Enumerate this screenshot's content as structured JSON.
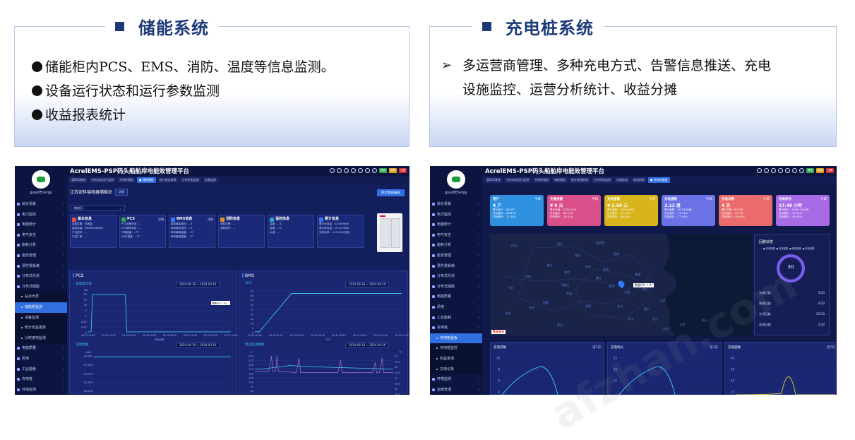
{
  "left_panel": {
    "title": "储能系统",
    "bullets": [
      "储能柜内PCS、EMS、消防、温度等信息监测。",
      "设备运行状态和运行参数监测",
      "收益报表统计"
    ]
  },
  "right_panel": {
    "title": "充电桩系统",
    "bullet_arrow": "➢",
    "bullet_lines": [
      "多运营商管理、多种充电方式、告警信息推送、充电",
      "设施监控、运营分析统计、收益分摊"
    ]
  },
  "app": {
    "title": "AcrelEMS-PSP码头船舶岸电能效管理平台",
    "brand": "guestEnergy",
    "top_tags": [
      {
        "label": "微信",
        "color": "#2fa84f"
      },
      {
        "label": "帮助",
        "color": "#e0a020"
      },
      {
        "label": "注销",
        "color": "#d03030"
      }
    ]
  },
  "shot1": {
    "tabs": [
      "管理驾驶舱",
      "光伏电站运行监测",
      "充电桩看板",
      "● 储能看板",
      "统计收益报表",
      "分时用电监测",
      "设备监测"
    ],
    "menu": [
      {
        "label": "综合看板",
        "type": "main"
      },
      {
        "label": "电力监控",
        "type": "main"
      },
      {
        "label": "电能统计",
        "type": "main"
      },
      {
        "label": "电气安全",
        "type": "main"
      },
      {
        "label": "能耗分析",
        "type": "main"
      },
      {
        "label": "能态管理",
        "type": "main"
      },
      {
        "label": "预付费系统",
        "type": "main"
      },
      {
        "label": "分布式光伏",
        "type": "main"
      },
      {
        "label": "分布式储能",
        "type": "main"
      },
      {
        "label": "站点大屏",
        "type": "sub"
      },
      {
        "label": "储能柜监测",
        "type": "sub-active"
      },
      {
        "label": "设备监测",
        "type": "sub"
      },
      {
        "label": "统计收益报表",
        "type": "sub"
      },
      {
        "label": "分时用电监测",
        "type": "sub"
      },
      {
        "label": "电能质量",
        "type": "main"
      },
      {
        "label": "风电",
        "type": "main"
      },
      {
        "label": "工业能耗",
        "type": "main"
      },
      {
        "label": "充电桩",
        "type": "main"
      },
      {
        "label": "环境监测",
        "type": "main"
      }
    ],
    "station": "江苏安科瑞电器储能站",
    "switch_label": "切换",
    "report_btn": "统计收益报表",
    "select_label": "储能柜1",
    "cards": [
      {
        "title": "基本信息",
        "color": "#e05050",
        "detail": "",
        "lines": [
          "站机位置：东面端",
          "装机容量：50kW/100kWh",
          "产品型号：--",
          "产品厂家：--"
        ]
      },
      {
        "title": "PCS",
        "color": "#2fa84f",
        "detail": "详情",
        "lines": [
          "PCS告警状态：--",
          "PCS故障状态：--",
          "环境温度：--℃",
          "IGBT温度：--℃"
        ]
      },
      {
        "title": "BMS信息",
        "color": "#3578ff",
        "detail": "详情",
        "lines": [
          "单体最高电压：--V",
          "单体最低电压：--V",
          "单体最高温度：--℃",
          "单体最低温度：--℃"
        ]
      },
      {
        "title": "消防信息",
        "color": "#e09020",
        "detail": "",
        "lines": [
          "消防告警：--",
          "消防动作：--"
        ]
      },
      {
        "title": "温控信息",
        "color": "#30a0d0",
        "detail": "",
        "lines": [
          "温度：--℃",
          "湿度：--%",
          "水浸：--"
        ]
      },
      {
        "title": "累计信息",
        "color": "#3578ff",
        "detail": "",
        "lines": [
          "累计充电量：31.08 MWh",
          "累计放电量：15.12 MWh",
          "当前功率：1.03 kW (充电)"
        ]
      }
    ],
    "pcs_section": "PCS",
    "bms_section": "BMS",
    "date_from": "2024-09-19",
    "date_to": "2024-09-19",
    "date_sep": "→",
    "charts": {
      "power": {
        "title": "充放电功率",
        "unit": "kW",
        "y_ticks": [
          "20",
          "15",
          "10",
          "5",
          "1",
          "0.67",
          "0.47",
          "0"
        ],
        "x_ticks": [
          "09 19 00:00",
          "09 19 02:50",
          "09 19 04:40",
          "09 19 06:30",
          "09 19 08:20",
          "09 19 11:10",
          "09 19 13:00",
          "09 19 14:15"
        ],
        "legend": "有功功率",
        "tooltip": "数据(kV + A)"
      },
      "soc": {
        "title": "SOC",
        "y_ticks": [
          "45",
          "40",
          "35",
          "30",
          "25",
          "20",
          "15",
          "10",
          "5",
          "0"
        ],
        "x_ticks": [
          "09 19 00:00",
          "09 19 02:10",
          "09 19 04:20",
          "09 19 06:30",
          "09 19 08:40",
          "09 19 10:50",
          "09 19 13:00",
          "09 19 14:15"
        ],
        "legend": "SOC"
      },
      "energy": {
        "title": "充放电量",
        "unit": "kWh",
        "y_ticks": [
          "30,000",
          "27,000",
          "24,000",
          "21,000",
          "18,000",
          "15,119.86"
        ],
        "x_ticks": [
          "09 19 00:00",
          "09 19 02:20",
          "09 19 04:40",
          "09 19 07:00",
          "09 19 09:20",
          "09 19 11:40",
          "09 19 14:00"
        ],
        "legend_a": "充电量",
        "legend_b": "放电量"
      },
      "cell_v": {
        "title": "电池监测曲线",
        "unit_left": "V",
        "unit_right": "℃",
        "y_ticks": [
          "250",
          "225",
          "200",
          "175",
          "150",
          "125",
          "100",
          "75",
          "50",
          "25",
          "0"
        ],
        "y_ticks_r": [
          "37",
          "35.5",
          "34",
          "32.5",
          "31",
          "29.5",
          "28",
          "26.5",
          "25"
        ],
        "x_ticks": [
          "09 19 00:00",
          "09 19 02:20",
          "09 19 04:40",
          "09 19 07:00",
          "09 19 09:20",
          "09 19 11:40",
          "09 19 14:00"
        ],
        "legend_a": "电压",
        "legend_b": "温度"
      }
    }
  },
  "shot2": {
    "tabs": [
      "管理驾驶舱",
      "光伏电站运行监测",
      "充电桩看板",
      "储能看板",
      "统计收益报表",
      "分时用电监测",
      "设备监测",
      "收益报表",
      "● 充电桩看板"
    ],
    "menu": [
      {
        "label": "综合看板",
        "type": "main"
      },
      {
        "label": "电力监控",
        "type": "main"
      },
      {
        "label": "电能统计",
        "type": "main"
      },
      {
        "label": "电气安全",
        "type": "main"
      },
      {
        "label": "能耗分析",
        "type": "main"
      },
      {
        "label": "能态管理",
        "type": "main"
      },
      {
        "label": "预付费系统",
        "type": "main"
      },
      {
        "label": "分布式光伏",
        "type": "main"
      },
      {
        "label": "分布式储能",
        "type": "main"
      },
      {
        "label": "电能质量",
        "type": "main"
      },
      {
        "label": "风电",
        "type": "main"
      },
      {
        "label": "工业能耗",
        "type": "main"
      },
      {
        "label": "充电桩",
        "type": "main"
      },
      {
        "label": "充电桩看板",
        "type": "sub-active"
      },
      {
        "label": "充电桩监控",
        "type": "sub"
      },
      {
        "label": "收益查询",
        "type": "sub"
      },
      {
        "label": "充电记录",
        "type": "sub"
      },
      {
        "label": "环境监测",
        "type": "main"
      },
      {
        "label": "运维管理",
        "type": "main"
      }
    ],
    "kpis": [
      {
        "title": "用户",
        "value": "4 户",
        "lines": [
          "累计用户：1621户",
          "环比增长：-56.67%",
          "同比增长：-21.58%"
        ],
        "color": "#2f90e0"
      },
      {
        "title": "充值金额",
        "value": "¥ 0 元",
        "lines": [
          "累计充值：1232.01元",
          "环比增长：-82.13%",
          "同比增长：-30.41%"
        ],
        "color": "#d94f8a"
      },
      {
        "title": "充电金额",
        "value": "¥ 2.50 元",
        "lines": [
          "累计金额：12844.06元",
          "环比增长：-72.87%",
          "同比增长：-66.63%"
        ],
        "color": "#d8b51d"
      },
      {
        "title": "充电度数",
        "value": "3.13 度",
        "lines": [
          "累计度数：25273.86度",
          "环比增长：-72.53%",
          "同比增长：-77.41%"
        ],
        "color": "#6a72e6"
      },
      {
        "title": "充电次数",
        "value": "4 次",
        "lines": [
          "累计次数：6145次",
          "环比增长：-47.1%",
          "同比增长：-46.41%"
        ],
        "color": "#ea6b6b"
      },
      {
        "title": "充电时长",
        "value": "17.48 小时",
        "lines": [
          "累计时长：17401.67小时",
          "环比增长：-42.74%",
          "同比增长：-45.91%"
        ],
        "color": "#a86be6"
      }
    ],
    "kpi_today": "今日",
    "map_labels": [
      "徐州",
      "宿迁",
      "连云港",
      "淮安",
      "盐城",
      "泰州",
      "南京",
      "扬州",
      "镇江",
      "常州",
      "无锡",
      "苏州",
      "上海",
      "嘉兴",
      "湖州",
      "杭州",
      "宣城",
      "芜湖",
      "马鞍山",
      "滁州",
      "合肥",
      "六安",
      "安庆",
      "铜陵",
      "池州",
      "黄山",
      "绍兴",
      "宁波",
      "舟山",
      "南通",
      "金华"
    ],
    "map_tooltip": "数据(kV + A)",
    "map_logo": "Baidu",
    "status": {
      "title": "回路状态",
      "legend": [
        "● 充电回路",
        "● 空闲回路",
        "● 离线回路",
        "● 其他回路"
      ],
      "total": "30",
      "rows": [
        {
          "label": "充电回路",
          "value": "3/30"
        },
        {
          "label": "故障回路",
          "value": "0/30"
        },
        {
          "label": "空闲回路",
          "value": "25/30"
        },
        {
          "label": "离线回路",
          "value": "2/30"
        }
      ]
    },
    "bottom": [
      {
        "title": "充电次数",
        "range": "近7日",
        "y_ticks": [
          "10",
          "8",
          "6",
          "4"
        ],
        "color": "#3fd3ff"
      },
      {
        "title": "充电时长",
        "range": "近7日",
        "y_ticks": [
          "25",
          "20",
          "15"
        ],
        "color": "#3fd3ff"
      },
      {
        "title": "充电度数",
        "range": "近7日",
        "y_ticks": [
          "40",
          "30",
          "20",
          "10"
        ],
        "color": "#e0d23f"
      }
    ]
  },
  "watermark": "afzhan.com"
}
